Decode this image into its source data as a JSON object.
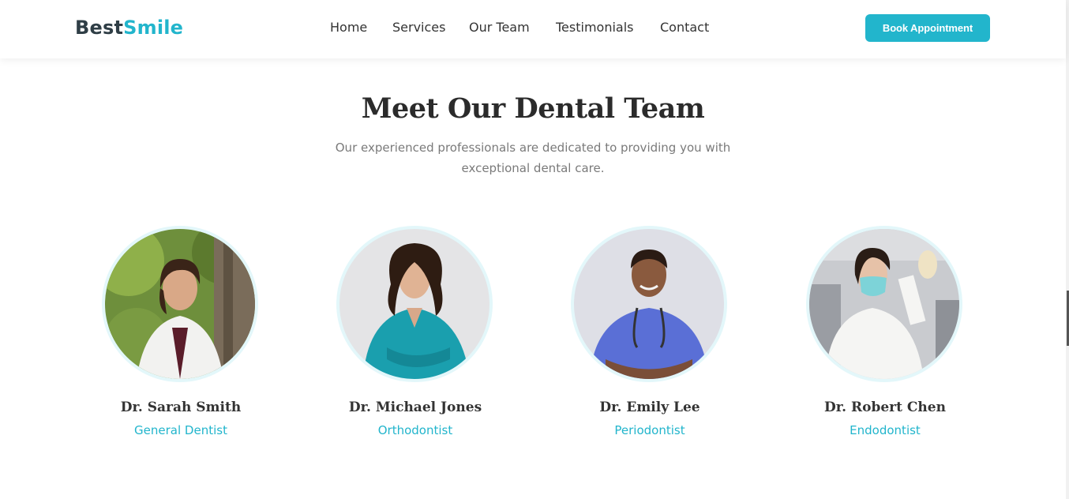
{
  "header": {
    "logo_part1": "Best",
    "logo_part2": "Smile",
    "nav": [
      "Home",
      "Services",
      "Our Team",
      "Testimonials",
      "Contact"
    ],
    "cta_label": "Book Appointment"
  },
  "team": {
    "title": "Meet Our Dental Team",
    "subtitle": "Our experienced professionals are dedicated to providing you with exceptional dental care.",
    "members": [
      {
        "name": "Dr. Sarah Smith",
        "role": "General Dentist"
      },
      {
        "name": "Dr. Michael Jones",
        "role": "Orthodontist"
      },
      {
        "name": "Dr. Emily Lee",
        "role": "Periodontist"
      },
      {
        "name": "Dr. Robert Chen",
        "role": "Endodontist"
      }
    ]
  },
  "colors": {
    "accent": "#22b5cc",
    "text_dark": "#2f3e46",
    "muted": "#7a7a7a",
    "avatar_ring": "#e3f7fa"
  }
}
